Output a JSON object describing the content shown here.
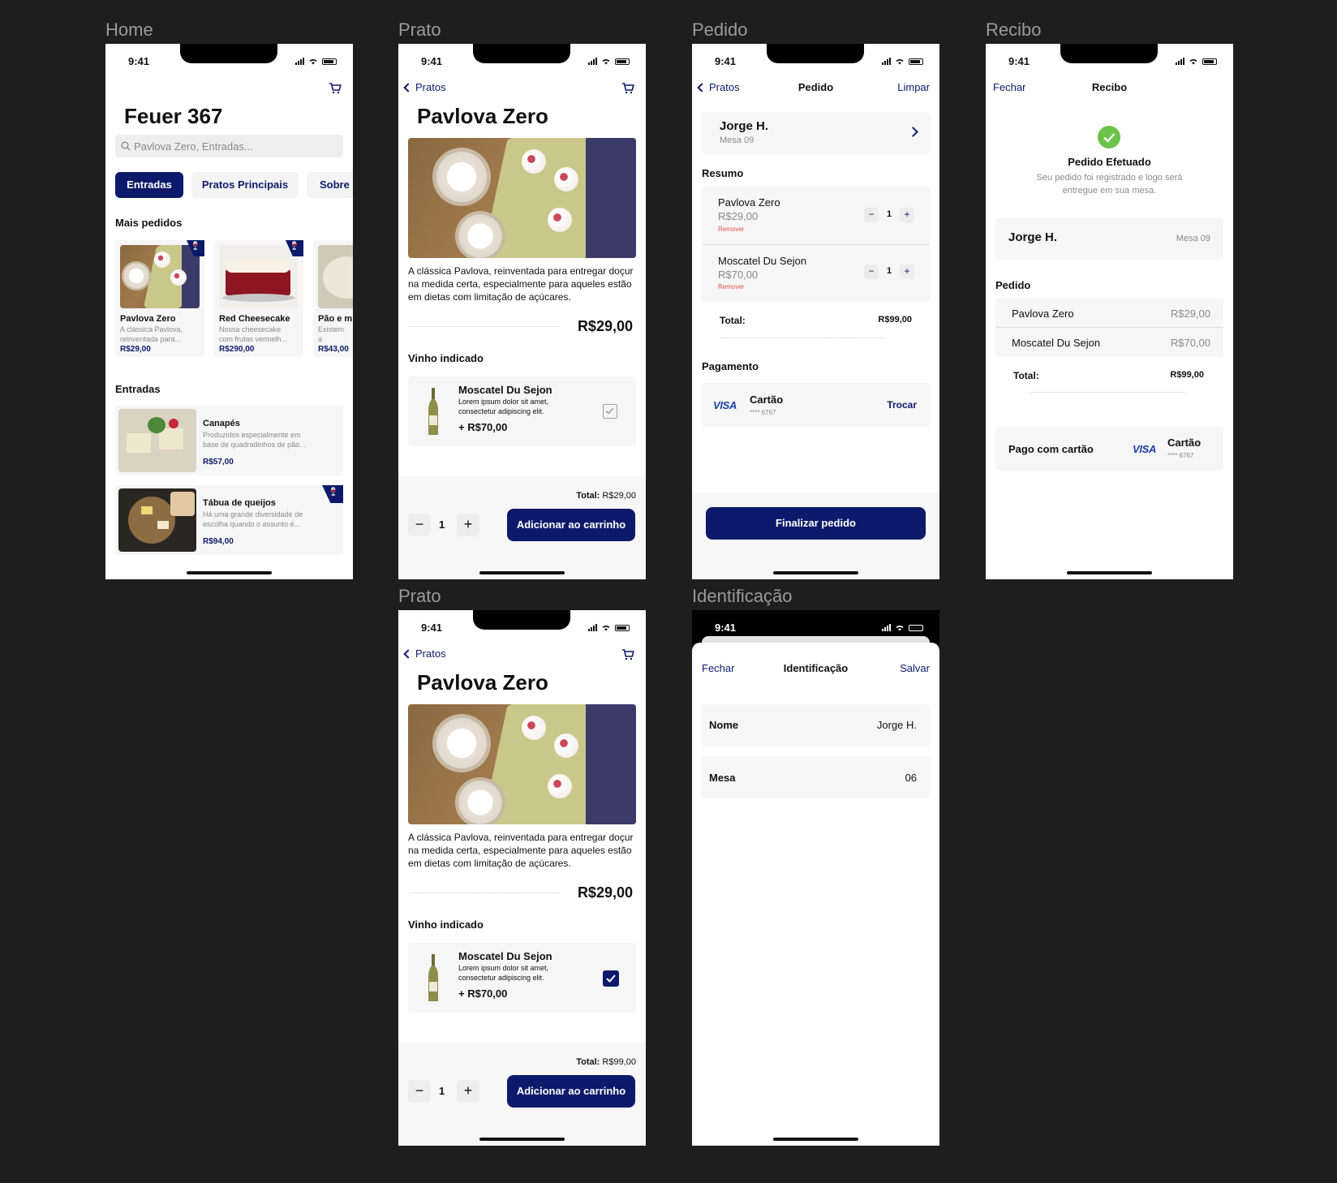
{
  "frames": {
    "home": "Home",
    "prato": "Prato",
    "pedido": "Pedido",
    "recibo": "Recibo",
    "prato2": "Prato",
    "identificacao": "Identificação"
  },
  "status_time": "9:41",
  "home": {
    "title": "Feuer 367",
    "search_placeholder": "Pavlova Zero, Entradas...",
    "tabs": [
      "Entradas",
      "Pratos Principais",
      "Sobre"
    ],
    "section_popular": "Mais pedidos",
    "popular": [
      {
        "name": "Pavlova Zero",
        "desc": "A clássica Pavlova, reinventada para...",
        "price": "R$29,00"
      },
      {
        "name": "Red Cheesecake",
        "desc": "Nossa cheesecake com frutas vermelh...",
        "price": "R$290,00"
      },
      {
        "name": "Pão e m",
        "desc": "Existem a molhos re",
        "price": "R$43,00"
      }
    ],
    "section_starters": "Entradas",
    "starters": [
      {
        "name": "Canapés",
        "desc": "Produzidos especialmente em base de quadradinhos de pão...",
        "price": "R$57,00"
      },
      {
        "name": "Tábua de queijos",
        "desc": "Há uma grande diversidade de escolha quando o assunto é...",
        "price": "R$94,00"
      }
    ]
  },
  "prato": {
    "back": "Pratos",
    "title": "Pavlova Zero",
    "description": "A clássica Pavlova, reinventada para entregar doçur na medida certa, especialmente para aqueles estão em dietas com limitação de açúcares.",
    "price": "R$29,00",
    "wine_heading": "Vinho indicado",
    "wine_name": "Moscatel Du Sejon",
    "wine_desc": "Lorem ipsum dolor sit amet, consectetur adipiscing elit.",
    "wine_price": "+ R$70,00",
    "total_label": "Total:",
    "total_value": "R$29,00",
    "qty": "1",
    "add_button": "Adicionar ao carrinho"
  },
  "prato2": {
    "total_value": "R$99,00"
  },
  "pedido": {
    "back": "Pratos",
    "title": "Pedido",
    "clear": "Limpar",
    "customer": "Jorge H.",
    "table": "Mesa 09",
    "summary_heading": "Resumo",
    "items": [
      {
        "name": "Pavlova Zero",
        "price": "R$29,00",
        "remove": "Remover",
        "qty": "1"
      },
      {
        "name": "Moscatel Du Sejon",
        "price": "R$70,00",
        "remove": "Remover",
        "qty": "1"
      }
    ],
    "total_label": "Total:",
    "total_value": "R$99,00",
    "payment_heading": "Pagamento",
    "card_brand": "VISA",
    "card_label": "Cartão",
    "card_number": "**** 6767",
    "change": "Trocar",
    "finish": "Finalizar pedido"
  },
  "recibo": {
    "close": "Fechar",
    "title": "Recibo",
    "success_title": "Pedido Efetuado",
    "success_desc": "Seu pedido foi registrado e logo será entregue em sua mesa.",
    "customer": "Jorge H.",
    "table": "Mesa 09",
    "order_heading": "Pedido",
    "items": [
      {
        "name": "Pavlova Zero",
        "price": "R$29,00"
      },
      {
        "name": "Moscatel Du Sejon",
        "price": "R$70,00"
      }
    ],
    "total_label": "Total:",
    "total_value": "R$99,00",
    "paid_label": "Pago com cartão",
    "card_brand": "VISA",
    "card_label": "Cartão",
    "card_number": "**** 6767"
  },
  "identificacao": {
    "close": "Fechar",
    "title": "Identificação",
    "save": "Salvar",
    "name_label": "Nome",
    "name_value": "Jorge H.",
    "table_label": "Mesa",
    "table_value": "06"
  },
  "colors": {
    "navy": "#0d1a6b",
    "success": "#6cc24a",
    "remove": "#e0524c",
    "background": "#1e1e1e"
  }
}
